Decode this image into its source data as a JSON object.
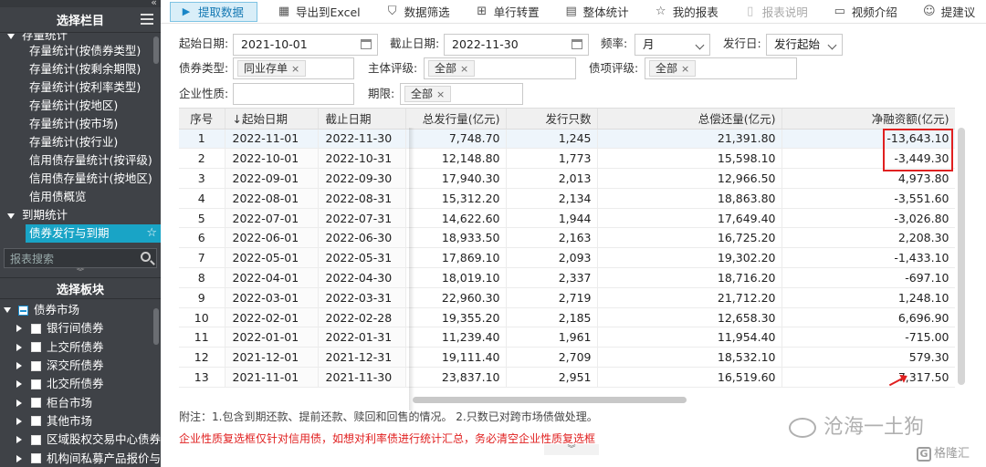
{
  "sidebar": {
    "top_collapse": "«",
    "title": "选择栏目",
    "partial_item": "存量统计",
    "items": [
      "存量统计(按债券类型)",
      "存量统计(按剩余期限)",
      "存量统计(按利率类型)",
      "存量统计(按地区)",
      "存量统计(按市场)",
      "存量统计(按行业)",
      "信用债存量统计(按评级)",
      "信用债存量统计(按地区)",
      "信用债概览"
    ],
    "group_due": "到期统计",
    "active_item": "债券发行与到期",
    "search_placeholder": "报表搜索",
    "split_glyph": "︾",
    "board_title": "选择板块",
    "board_root": "债券市场",
    "board_items": [
      "银行间债券",
      "上交所债券",
      "深交所债券",
      "北交所债券",
      "柜台市场",
      "其他市场",
      "区域股权交易中心债券",
      "机构间私募产品报价与"
    ]
  },
  "toolbar": {
    "fetch": "提取数据",
    "export": "导出到Excel",
    "filter": "数据筛选",
    "transpose": "单行转置",
    "stats": "整体统计",
    "my_report": "我的报表",
    "report_desc": "报表说明",
    "video": "视频介绍",
    "suggest": "提建议"
  },
  "filters": {
    "start_label": "起始日期:",
    "start_value": "2021-10-01",
    "end_label": "截止日期:",
    "end_value": "2022-11-30",
    "freq_label": "频率:",
    "freq_value": "月",
    "issue_label": "发行日:",
    "issue_value": "发行起始",
    "bond_type_label": "债券类型:",
    "bond_type_tag": "同业存单",
    "issuer_rating_label": "主体评级:",
    "issuer_rating_tag": "全部",
    "bond_rating_label": "债项评级:",
    "bond_rating_tag": "全部",
    "nature_label": "企业性质:",
    "nature_value": "",
    "term_label": "期限:",
    "term_tag": "全部",
    "tag_close": "×"
  },
  "table": {
    "headers": [
      "序号",
      "↓起始日期",
      "截止日期",
      "总发行量(亿元)",
      "发行只数",
      "总偿还量(亿元)",
      "净融资额(亿元)"
    ],
    "rows": [
      [
        "1",
        "2022-11-01",
        "2022-11-30",
        "7,748.70",
        "1,245",
        "21,391.80",
        "-13,643.10"
      ],
      [
        "2",
        "2022-10-01",
        "2022-10-31",
        "12,148.80",
        "1,773",
        "15,598.10",
        "-3,449.30"
      ],
      [
        "3",
        "2022-09-01",
        "2022-09-30",
        "17,940.30",
        "2,013",
        "12,966.50",
        "4,973.80"
      ],
      [
        "4",
        "2022-08-01",
        "2022-08-31",
        "15,312.20",
        "2,134",
        "18,863.80",
        "-3,551.60"
      ],
      [
        "5",
        "2022-07-01",
        "2022-07-31",
        "14,622.60",
        "1,944",
        "17,649.40",
        "-3,026.80"
      ],
      [
        "6",
        "2022-06-01",
        "2022-06-30",
        "18,933.50",
        "2,163",
        "16,725.20",
        "2,208.30"
      ],
      [
        "7",
        "2022-05-01",
        "2022-05-31",
        "17,869.10",
        "2,093",
        "19,302.20",
        "-1,433.10"
      ],
      [
        "8",
        "2022-04-01",
        "2022-04-30",
        "18,019.10",
        "2,337",
        "18,716.20",
        "-697.10"
      ],
      [
        "9",
        "2022-03-01",
        "2022-03-31",
        "22,960.30",
        "2,719",
        "21,712.20",
        "1,248.10"
      ],
      [
        "10",
        "2022-02-01",
        "2022-02-28",
        "19,355.20",
        "2,185",
        "12,658.30",
        "6,696.90"
      ],
      [
        "11",
        "2022-01-01",
        "2022-01-31",
        "11,239.40",
        "1,961",
        "11,954.40",
        "-715.00"
      ],
      [
        "12",
        "2021-12-01",
        "2021-12-31",
        "19,111.40",
        "2,709",
        "18,532.10",
        "579.30"
      ],
      [
        "13",
        "2021-11-01",
        "2021-11-30",
        "23,837.10",
        "2,951",
        "16,519.60",
        "7,317.50"
      ]
    ]
  },
  "footer": {
    "note": "附注：1.包含到期还款、提前还款、赎回和回售的情况。  2.只数已对跨市场债做处理。",
    "warning": "企业性质复选框仅针对信用债，如想对利率债进行统计汇总，务必清空企业性质复选框",
    "toggle": "︾"
  },
  "watermark": {
    "text": "沧海一土狗",
    "logo": "格隆汇",
    "logo_glyph": "G"
  },
  "colors": {
    "accent": "#19a4c6",
    "sidebar_bg": "#3f4247",
    "highlight_red": "#e02020"
  }
}
